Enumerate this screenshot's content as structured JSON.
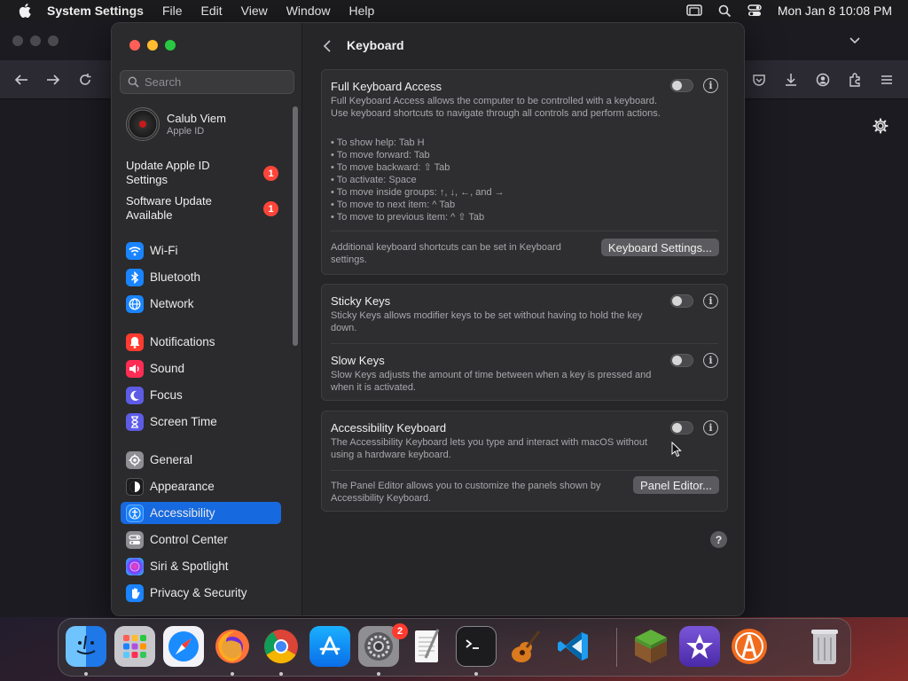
{
  "menubar": {
    "app_name": "System Settings",
    "menus": [
      "File",
      "Edit",
      "View",
      "Window",
      "Help"
    ],
    "clock": "Mon Jan 8  10:08 PM"
  },
  "sidebar": {
    "search_placeholder": "Search",
    "profile": {
      "name": "Calub Viem",
      "subtitle": "Apple ID"
    },
    "notices": [
      {
        "label": "Update Apple ID Settings",
        "badge": "1"
      },
      {
        "label": "Software Update Available",
        "badge": "1"
      }
    ],
    "items": [
      {
        "label": "Wi-Fi",
        "icon": "wifi-icon",
        "color": "#1a84ff"
      },
      {
        "label": "Bluetooth",
        "icon": "bluetooth-icon",
        "color": "#1a84ff"
      },
      {
        "label": "Network",
        "icon": "globe-icon",
        "color": "#1a84ff"
      },
      {
        "label": "Notifications",
        "icon": "bell-icon",
        "color": "#ff3b30"
      },
      {
        "label": "Sound",
        "icon": "speaker-icon",
        "color": "#ff2d55"
      },
      {
        "label": "Focus",
        "icon": "moon-icon",
        "color": "#5e5ce6"
      },
      {
        "label": "Screen Time",
        "icon": "hourglass-icon",
        "color": "#5e5ce6"
      },
      {
        "label": "General",
        "icon": "gear-icon",
        "color": "#8e8e93"
      },
      {
        "label": "Appearance",
        "icon": "appearance-icon",
        "color": "#1c1c1e"
      },
      {
        "label": "Accessibility",
        "icon": "accessibility-icon",
        "color": "#1a84ff"
      },
      {
        "label": "Control Center",
        "icon": "switches-icon",
        "color": "#8e8e93"
      },
      {
        "label": "Siri & Spotlight",
        "icon": "siri-icon",
        "color": "#222244"
      },
      {
        "label": "Privacy & Security",
        "icon": "hand-icon",
        "color": "#1a84ff"
      }
    ],
    "active": "Accessibility"
  },
  "main": {
    "title": "Keyboard",
    "full_keyboard_access": {
      "title": "Full Keyboard Access",
      "description": "Full Keyboard Access allows the computer to be controlled with a keyboard. Use keyboard shortcuts to navigate through all controls and perform actions.",
      "shortcuts": [
        "• To show help: Tab H",
        "• To move forward: Tab",
        "• To move backward: ⇧ Tab",
        "• To activate: Space",
        "• To move inside groups: ↑, ↓, ←, and →",
        "• To move to next item: ^ Tab",
        "• To move to previous item: ^ ⇧ Tab"
      ],
      "enabled": false,
      "footer": "Additional keyboard shortcuts can be set in Keyboard settings.",
      "button": "Keyboard Settings..."
    },
    "sticky_keys": {
      "title": "Sticky Keys",
      "description": "Sticky Keys allows modifier keys to be set without having to hold the key down.",
      "enabled": false
    },
    "slow_keys": {
      "title": "Slow Keys",
      "description": "Slow Keys adjusts the amount of time between when a key is pressed and when it is activated.",
      "enabled": false
    },
    "accessibility_keyboard": {
      "title": "Accessibility Keyboard",
      "description": "The Accessibility Keyboard lets you type and interact with macOS without using a hardware keyboard.",
      "enabled": false,
      "footer": "The Panel Editor allows you to customize the panels shown by Accessibility Keyboard.",
      "button": "Panel Editor..."
    },
    "help": "?"
  },
  "dock": {
    "apps": [
      "finder-icon",
      "launchpad-icon",
      "safari-icon",
      "firefox-icon",
      "chrome-icon",
      "app-store-icon",
      "system-settings-icon",
      "textedit-icon",
      "terminal-icon",
      "garageband-icon",
      "vscode-icon",
      "minecraft-icon",
      "imovie-icon",
      "app-icon",
      "trash-icon"
    ],
    "system_settings_badge": "2"
  }
}
